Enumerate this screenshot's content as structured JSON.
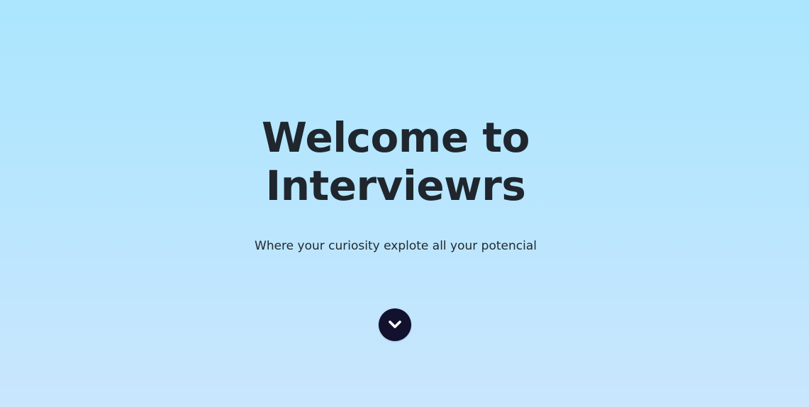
{
  "hero": {
    "title_line1": "Welcome to",
    "title_line2": "Interviewrs",
    "subtitle": "Where your curiosity explote all your potencial",
    "scroll_button_icon": "chevron-down-icon"
  },
  "colors": {
    "background_top": "#abe6fe",
    "background_bottom": "#c9e6fd",
    "text": "#1f262d",
    "button": "#12112e",
    "button_icon": "#ffffff"
  }
}
